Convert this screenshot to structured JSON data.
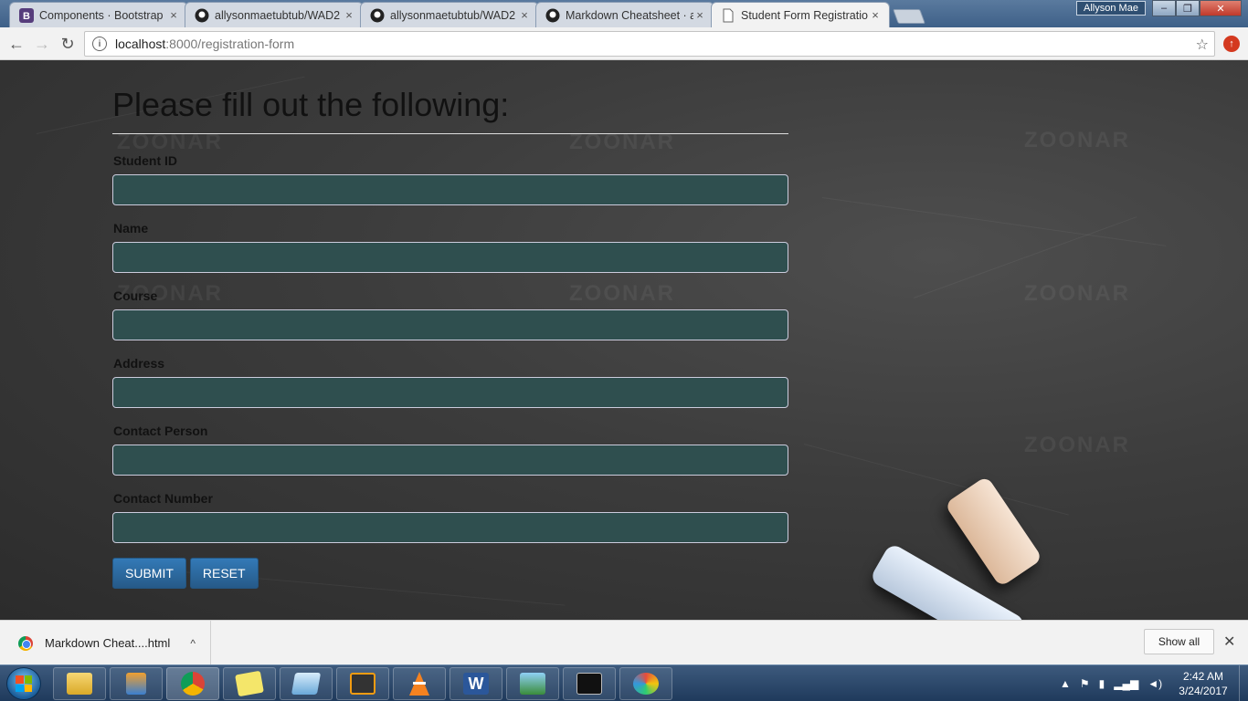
{
  "browser": {
    "tabs": [
      {
        "title": "Components · Bootstrap",
        "icon": "bootstrap-icon",
        "close": "×"
      },
      {
        "title": "allysonmaetubtub/WAD2",
        "icon": "github-icon",
        "close": "×"
      },
      {
        "title": "allysonmaetubtub/WAD2",
        "icon": "github-icon",
        "close": "×"
      },
      {
        "title": "Markdown Cheatsheet · a",
        "icon": "github-icon",
        "close": "×"
      },
      {
        "title": "Student Form Registratio",
        "icon": "page-icon",
        "close": "×"
      }
    ],
    "user_badge": "Allyson Mae",
    "window_controls": {
      "minimize": "–",
      "maximize": "❐",
      "close": "✕"
    },
    "nav": {
      "back": "←",
      "forward": "→",
      "reload": "↻"
    },
    "address": {
      "info": "i",
      "host": "localhost",
      "path": ":8000/registration-form",
      "star": "☆"
    },
    "extension": "↑"
  },
  "form": {
    "heading": "Please fill out the following:",
    "fields": [
      {
        "label": "Student ID",
        "value": ""
      },
      {
        "label": "Name",
        "value": ""
      },
      {
        "label": "Course",
        "value": ""
      },
      {
        "label": "Address",
        "value": ""
      },
      {
        "label": "Contact Person",
        "value": ""
      },
      {
        "label": "Contact Number",
        "value": ""
      }
    ],
    "submit_label": "SUBMIT",
    "reset_label": "RESET"
  },
  "background": {
    "watermark": "ZOONAR"
  },
  "downloads": {
    "item_name": "Markdown Cheat....html",
    "chevron": "^",
    "show_all_label": "Show all",
    "close": "✕"
  },
  "taskbar": {
    "apps": [
      "explorer-icon",
      "media-player-icon",
      "chrome-icon",
      "sticky-notes-icon",
      "notepad-icon",
      "sublime-text-icon",
      "vlc-icon",
      "word-icon",
      "photos-icon",
      "cmd-icon",
      "paint-icon"
    ],
    "clock_time": "2:42 AM",
    "clock_date": "3/24/2017"
  },
  "colors": {
    "input_bg": "#2f4f4f",
    "button_bg": "#337ab7",
    "page_bg": "#3c3c3c"
  }
}
